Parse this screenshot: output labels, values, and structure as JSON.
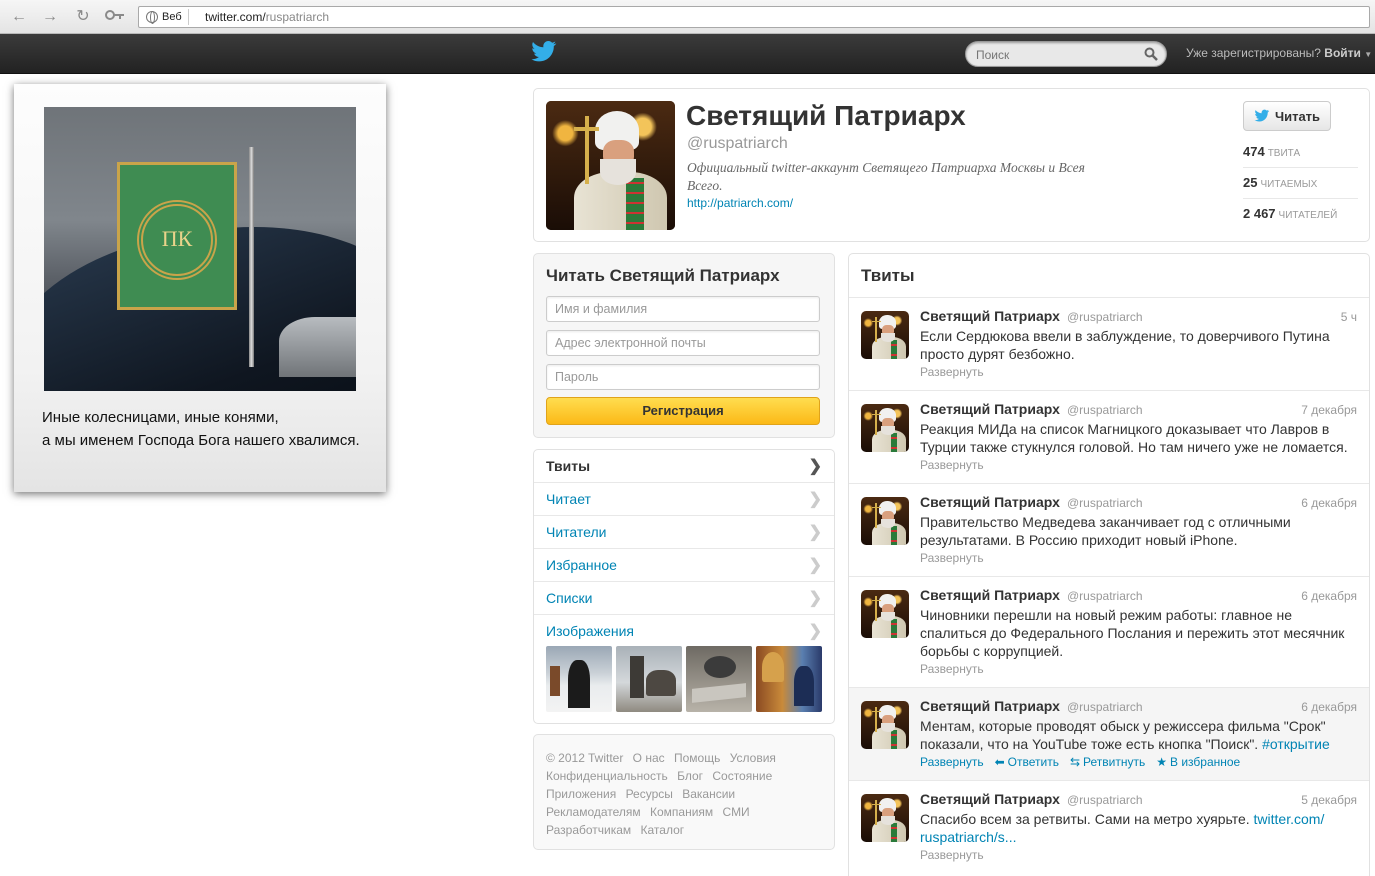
{
  "browser": {
    "omnibox_chip": "Веб",
    "url_host": "twitter.com/",
    "url_path": "ruspatriarch"
  },
  "topbar": {
    "search_placeholder": "Поиск",
    "login_question": "Уже зарегистрированы?",
    "login_link": "Войти"
  },
  "ad": {
    "line1": "Иные колесницами, иные конями,",
    "line2": "а мы именем Господа Бога нашего хвалимся."
  },
  "profile": {
    "name": "Светящий Патриарх",
    "handle": "@ruspatriarch",
    "bio": "Официальный twitter-аккаунт Светящего Патриарха Москвы и Всея Всего.",
    "url": "http://patriarch.com/",
    "follow_label": "Читать",
    "stats": [
      {
        "value": "474",
        "label": "твита"
      },
      {
        "value": "25",
        "label": "читаемых"
      },
      {
        "value": "2 467",
        "label": "читателей"
      }
    ]
  },
  "signup": {
    "title": "Читать Светящий Патриарх",
    "name_placeholder": "Имя и фамилия",
    "email_placeholder": "Адрес электронной почты",
    "password_placeholder": "Пароль",
    "button": "Регистрация"
  },
  "nav": {
    "items": [
      {
        "label": "Твиты"
      },
      {
        "label": "Читает"
      },
      {
        "label": "Читатели"
      },
      {
        "label": "Избранное"
      },
      {
        "label": "Списки"
      },
      {
        "label": "Изображения"
      }
    ]
  },
  "footer": {
    "links": [
      "© 2012 Twitter",
      "О нас",
      "Помощь",
      "Условия",
      "Конфиденциальность",
      "Блог",
      "Состояние",
      "Приложения",
      "Ресурсы",
      "Вакансии",
      "Рекламодателям",
      "Компаниям",
      "СМИ",
      "Разработчикам",
      "Каталог"
    ]
  },
  "timeline": {
    "title": "Твиты",
    "expand_label": "Развернуть",
    "actions": {
      "reply": "Ответить",
      "retweet": "Ретвитнуть",
      "favorite": "В избранное"
    },
    "tweets": [
      {
        "name": "Светящий Патриарх",
        "handle": "@ruspatriarch",
        "time": "5 ч",
        "text": "Если Сердюкова ввели в заблуждение, то доверчивого Путина просто дурят безбожно."
      },
      {
        "name": "Светящий Патриарх",
        "handle": "@ruspatriarch",
        "time": "7 декабря",
        "text": "Реакция МИДа на список Магницкого доказывает что Лавров в Турции также стукнулся головой. Но там ничего уже не ломается."
      },
      {
        "name": "Светящий Патриарх",
        "handle": "@ruspatriarch",
        "time": "6 декабря",
        "text": "Правительство Медведева заканчивает год с отличными результатами. В Россию приходит новый iPhone."
      },
      {
        "name": "Светящий Патриарх",
        "handle": "@ruspatriarch",
        "time": "6 декабря",
        "text": "Чиновники перешли на новый режим работы: главное не спалиться до Федерального Послания и пережить этот месячник борьбы с коррупцией."
      },
      {
        "name": "Светящий Патриарх",
        "handle": "@ruspatriarch",
        "time": "6 декабря",
        "text": "Ментам, которые проводят обыск у режиссера фильма \"Срок\" показали, что на YouTube тоже есть кнопка \"Поиск\".",
        "link": "#открытие"
      },
      {
        "name": "Светящий Патриарх",
        "handle": "@ruspatriarch",
        "time": "5 декабря",
        "text": "Спасибо всем за ретвиты. Сами на метро хуярьте.",
        "link": "twitter.com/ ruspatriarch/s..."
      }
    ]
  },
  "colors": {
    "link": "#0084b4",
    "topbar": "#2b2b2b",
    "signup_button": "#fbb917",
    "twitter_blue": "#33aee8"
  }
}
